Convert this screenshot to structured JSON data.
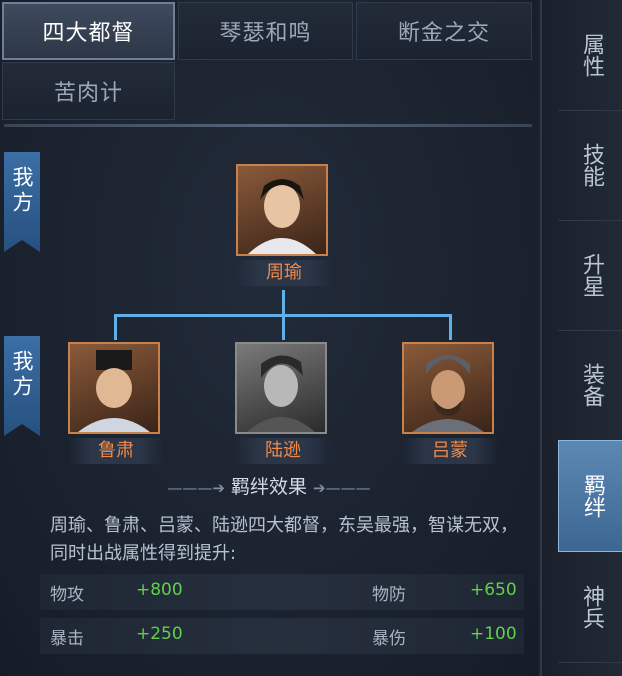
{
  "tabs": [
    "四大都督",
    "琴瑟和鸣",
    "断金之交",
    "苦肉计"
  ],
  "side_tag_label": "我方",
  "side_tag_label_2": "我方",
  "leader": {
    "name": "周瑜"
  },
  "members": [
    {
      "name": "鲁肃"
    },
    {
      "name": "陆逊"
    },
    {
      "name": "吕蒙"
    }
  ],
  "effect": {
    "title": "羁绊效果",
    "description": "周瑜、鲁肃、吕蒙、陆逊四大都督，东吴最强，智谋无双，同时出战属性得到提升:",
    "stats": [
      {
        "label": "物攻",
        "value": "+800"
      },
      {
        "label": "物防",
        "value": "+650"
      },
      {
        "label": "暴击",
        "value": "+250"
      },
      {
        "label": "暴伤",
        "value": "+100"
      }
    ]
  },
  "sidebar": [
    "属性",
    "技能",
    "升星",
    "装备",
    "羁绊",
    "神兵"
  ],
  "colors": {
    "accent": "#5fb0e6",
    "name": "#f08a4b",
    "bonus": "#5fd14a",
    "active_tab": "#3d6792"
  }
}
